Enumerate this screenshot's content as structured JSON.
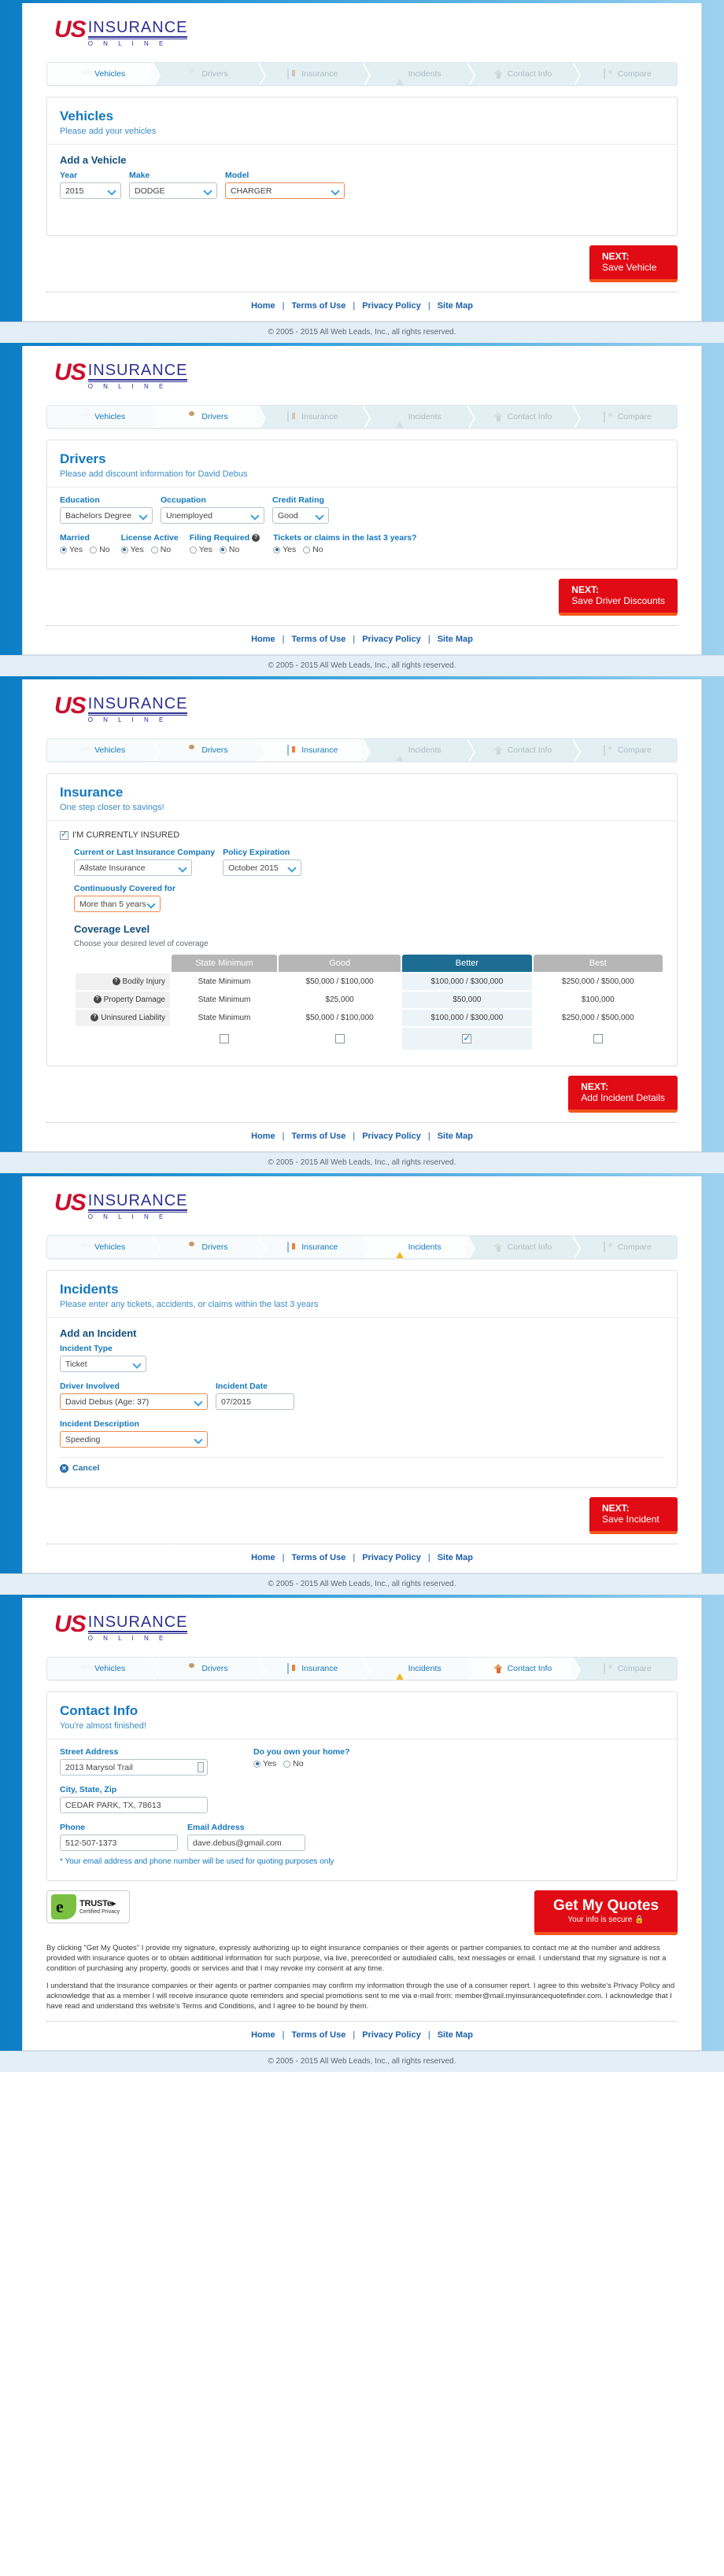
{
  "brand": {
    "logo_us": "US",
    "logo_insurance": "INSURANCE",
    "logo_online": "O N L I N E",
    "accent_red": "#cc0e2d",
    "accent_blue": "#2e3192",
    "link_blue": "#1478be",
    "cta_red": "#e00b14",
    "selected_col": "#1d6d92"
  },
  "wizard": {
    "steps": [
      {
        "label": "Vehicles",
        "icon": "car-icon"
      },
      {
        "label": "Drivers",
        "icon": "person-icon"
      },
      {
        "label": "Insurance",
        "icon": "id-card-icon"
      },
      {
        "label": "Incidents",
        "icon": "warning-icon"
      },
      {
        "label": "Contact Info",
        "icon": "home-icon"
      },
      {
        "label": "Compare",
        "icon": "money-icon"
      }
    ]
  },
  "footer": {
    "links": [
      "Home",
      "Terms of Use",
      "Privacy Policy",
      "Site Map"
    ],
    "separator": "|",
    "copyright": "© 2005 - 2015 All Web Leads, Inc., all rights reserved."
  },
  "panels": [
    {
      "active_step": 0,
      "title": "Vehicles",
      "subtitle": "Please add your vehicles",
      "section_title": "Add a Vehicle",
      "fields": [
        {
          "label": "Year",
          "value": "2015",
          "highlight": false,
          "width": 78
        },
        {
          "label": "Make",
          "value": "DODGE",
          "highlight": false,
          "width": 112
        },
        {
          "label": "Model",
          "value": "CHARGER",
          "highlight": true,
          "width": 152
        }
      ],
      "next": {
        "line1": "NEXT:",
        "line2": "Save Vehicle"
      }
    },
    {
      "active_step": 1,
      "title": "Drivers",
      "subtitle": "Please add discount information for David Debus",
      "selects": [
        {
          "label": "Education",
          "value": "Bachelors Degree",
          "width": 118
        },
        {
          "label": "Occupation",
          "value": "Unemployed",
          "width": 132
        },
        {
          "label": "Credit Rating",
          "value": "Good",
          "width": 72
        }
      ],
      "radio_groups": [
        {
          "label": "Married",
          "options": [
            "Yes",
            "No"
          ],
          "selected": "Yes",
          "help": false
        },
        {
          "label": "License Active",
          "options": [
            "Yes",
            "No"
          ],
          "selected": "Yes",
          "help": false
        },
        {
          "label": "Filing Required",
          "options": [
            "Yes",
            "No"
          ],
          "selected": "No",
          "help": true
        },
        {
          "label": "Tickets or claims in the last 3 years?",
          "options": [
            "Yes",
            "No"
          ],
          "selected": "Yes",
          "help": false
        }
      ],
      "next": {
        "line1": "NEXT:",
        "line2": "Save Driver Discounts"
      }
    },
    {
      "active_step": 2,
      "title": "Insurance",
      "subtitle": "One step closer to savings!",
      "insured_checkbox": {
        "label": "I'M CURRENTLY INSURED",
        "checked": true
      },
      "selects": [
        {
          "label": "Current or Last Insurance Company",
          "value": "Allstate Insurance",
          "width": 150,
          "highlight": false
        },
        {
          "label": "Policy Expiration",
          "value": "October 2015",
          "width": 100,
          "highlight": false
        },
        {
          "label": "Continuously Covered for",
          "value": "More than 5 years",
          "width": 110,
          "highlight": true
        }
      ],
      "coverage": {
        "title": "Coverage Level",
        "subtitle": "Choose your desired level of coverage",
        "columns": [
          "State Minimum",
          "Good",
          "Better",
          "Best"
        ],
        "selected_column": "Better",
        "rows": [
          {
            "label": "Bodily Injury",
            "values": [
              "State Minimum",
              "$50,000 / $100,000",
              "$100,000 / $300,000",
              "$250,000 / $500,000"
            ]
          },
          {
            "label": "Property Damage",
            "values": [
              "State Minimum",
              "$25,000",
              "$50,000",
              "$100,000"
            ]
          },
          {
            "label": "Uninsured Liability",
            "values": [
              "State Minimum",
              "$50,000 / $100,000",
              "$100,000 / $300,000",
              "$250,000 / $500,000"
            ]
          }
        ],
        "checkboxes": [
          false,
          false,
          true,
          false
        ]
      },
      "next": {
        "line1": "NEXT:",
        "line2": "Add Incident Details"
      }
    },
    {
      "active_step": 3,
      "title": "Incidents",
      "subtitle": "Please enter any tickets, accidents, or claims within the last 3 years",
      "section_title": "Add an Incident",
      "incident_type": {
        "label": "Incident Type",
        "value": "Ticket",
        "width": 110
      },
      "driver_involved": {
        "label": "Driver Involved",
        "value": "David Debus (Age: 37)",
        "width": 188
      },
      "incident_date": {
        "label": "Incident Date",
        "value": "07/2015",
        "width": 100
      },
      "incident_description": {
        "label": "Incident Description",
        "value": "Speeding",
        "width": 188
      },
      "cancel_label": "Cancel",
      "next": {
        "line1": "NEXT:",
        "line2": "Save Incident"
      }
    },
    {
      "active_step": 4,
      "title": "Contact Info",
      "subtitle": "You're almost finished!",
      "street": {
        "label": "Street Address",
        "value": "2013 Marysol Trail",
        "width": 188
      },
      "own_home": {
        "label": "Do you own your home?",
        "options": [
          "Yes",
          "No"
        ],
        "selected": "Yes"
      },
      "city": {
        "label": "City, State, Zip",
        "value": "CEDAR PARK, TX, 78613",
        "width": 188
      },
      "phone": {
        "label": "Phone",
        "value": "512-507-1373",
        "width": 150
      },
      "email": {
        "label": "Email Address",
        "value": "dave.debus@gmail.com",
        "width": 150
      },
      "quoting_note": "* Your email address and phone number will be used for quoting purposes only",
      "truste": {
        "title": "TRUSTe",
        "arrow": "▸",
        "subtitle": "Certified Privacy"
      },
      "cta": {
        "line1": "Get My Quotes",
        "line2": "Your info is secure",
        "lock": "🔒"
      },
      "legal_p1": "By clicking \"Get My Quotes\" I provide my signature, expressly authorizing up to eight insurance companies or their agents or partner companies to contact me at the number and address provided with insurance quotes or to obtain additional information for such purpose, via live, prerecorded or autodialed calls, text messages or email. I understand that my signature is not a condition of purchasing any property, goods or services and that I may revoke my consent at any time.",
      "legal_p2": "I understand that the insurance companies or their agents or partner companies may confirm my information through the use of a consumer report. I agree to this website's Privacy Policy and acknowledge that as a member I will receive insurance quote reminders and special promotions sent to me via e-mail from: member@mail.myinsurancequotefinder.com. I acknowledge that I have read and understand this website's Terms and Conditions, and I agree to be bound by them."
    }
  ]
}
